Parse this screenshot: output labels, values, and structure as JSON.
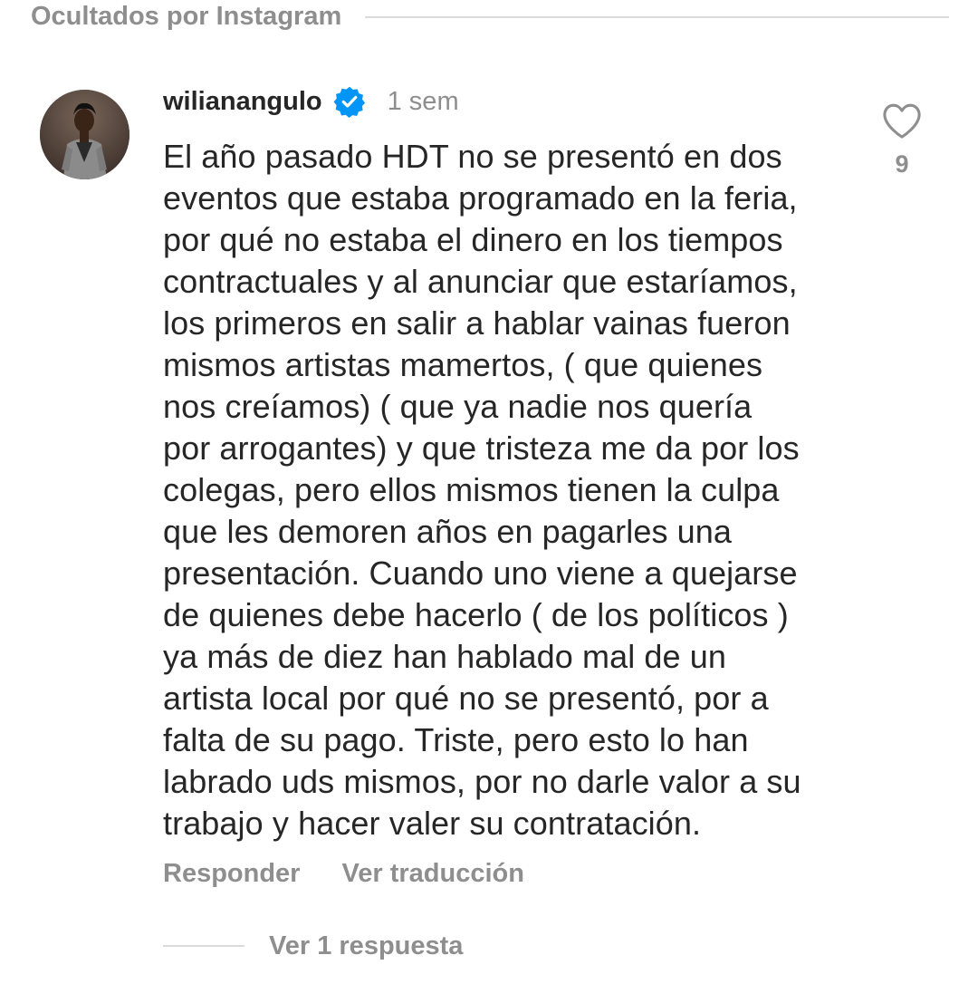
{
  "section": {
    "hidden_label": "Ocultados por Instagram"
  },
  "comment": {
    "username": "wilianangulo",
    "verified_icon": "verified-badge-icon",
    "time": "1 sem",
    "lines": [
      "El año pasado HDT no se presentó en dos",
      "eventos que estaba programado en la feria,",
      "por qué no estaba el dinero en los tiempos",
      "contractuales y al anunciar que estaríamos,",
      "los primeros en salir a hablar vainas fueron",
      "mismos artistas mamertos, ( que quienes",
      "nos creíamos) ( que ya nadie nos quería",
      "por arrogantes) y que tristeza me da por los",
      "colegas, pero ellos mismos tienen la culpa",
      "que les demoren años en pagarles una",
      "presentación. Cuando uno viene a quejarse",
      "de quienes debe hacerlo ( de los políticos )",
      "ya más de diez han hablado mal de un",
      "artista local por qué no se presentó, por a",
      "falta de su pago. Triste, pero esto lo han",
      "labrado uds mismos, por no darle valor a su",
      "trabajo y hacer valer su contratación."
    ],
    "like_icon": "heart-outline-icon",
    "like_count": "9",
    "actions": {
      "reply": "Responder",
      "translate": "Ver traducción"
    },
    "replies_label": "Ver 1 respuesta"
  },
  "colors": {
    "text_primary": "#262626",
    "text_secondary": "#8e8e8e",
    "divider": "#dbdbdb",
    "verified_blue": "#0095f6"
  }
}
